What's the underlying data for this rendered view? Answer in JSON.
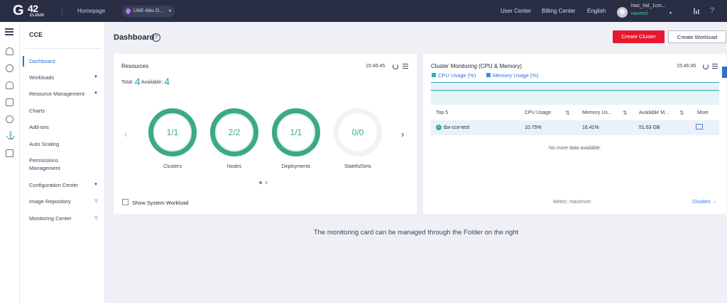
{
  "topbar": {
    "logo_main": "G",
    "logo_num": "42",
    "logo_sub": "CLOUD",
    "home": "Homepage",
    "region": "UAE-Abu D...",
    "user_center": "User Center",
    "billing_center": "Billing Center",
    "language": "English",
    "username": "hwc_hid_1cm...",
    "user_sub": "naveed",
    "help": "?"
  },
  "sidenav": {
    "title": "CCE",
    "items": [
      {
        "label": "Dashboard"
      },
      {
        "label": "Workloads"
      },
      {
        "label": "Resource Management"
      },
      {
        "label": "Charts"
      },
      {
        "label": "Add-ons"
      },
      {
        "label": "Auto Scaling"
      },
      {
        "label": "Permissions"
      },
      {
        "label": "Management"
      },
      {
        "label": "Configuration Center"
      },
      {
        "label": "Image Repository"
      },
      {
        "label": "Monitoring Center"
      }
    ]
  },
  "header": {
    "title": "Dashboard",
    "create_cluster": "Create Cluster",
    "create_workload": "Create Workload"
  },
  "resources": {
    "title": "Resources",
    "time": "15:46:45",
    "total_label": "Total:",
    "total": "4",
    "available_label": "Available:",
    "available": "4",
    "rings": [
      {
        "value": "1/1",
        "label": "Clusters"
      },
      {
        "value": "2/2",
        "label": "Nodes"
      },
      {
        "value": "1/1",
        "label": "Deployments"
      },
      {
        "value": "0/0",
        "label": "StatefulSets"
      }
    ],
    "show_system": "Show System Workload"
  },
  "monitoring": {
    "title": "Cluster Monitoring (CPU & Memory)",
    "time": "15:46:45",
    "legend_cpu": "CPU Usage (%)",
    "legend_mem": "Memory Usage (%)",
    "columns": [
      "Top 5",
      "CPU Usage",
      "Memory Us...",
      "Available M...",
      "More"
    ],
    "row": {
      "name": "tbx-cce-test",
      "cpu": "10.75%",
      "mem": "16.41%",
      "avail": "51.63 GB"
    },
    "no_more": "No more data available.",
    "metric": "Metric: maximum",
    "clusters_link": "Clusters →"
  },
  "hint": "The monitoring card can be managed through the Folder on the right",
  "colors": {
    "accent": "#2e6fd8",
    "ring": "#3aa98a",
    "danger": "#e6182d",
    "topbar": "#2a2e45"
  }
}
